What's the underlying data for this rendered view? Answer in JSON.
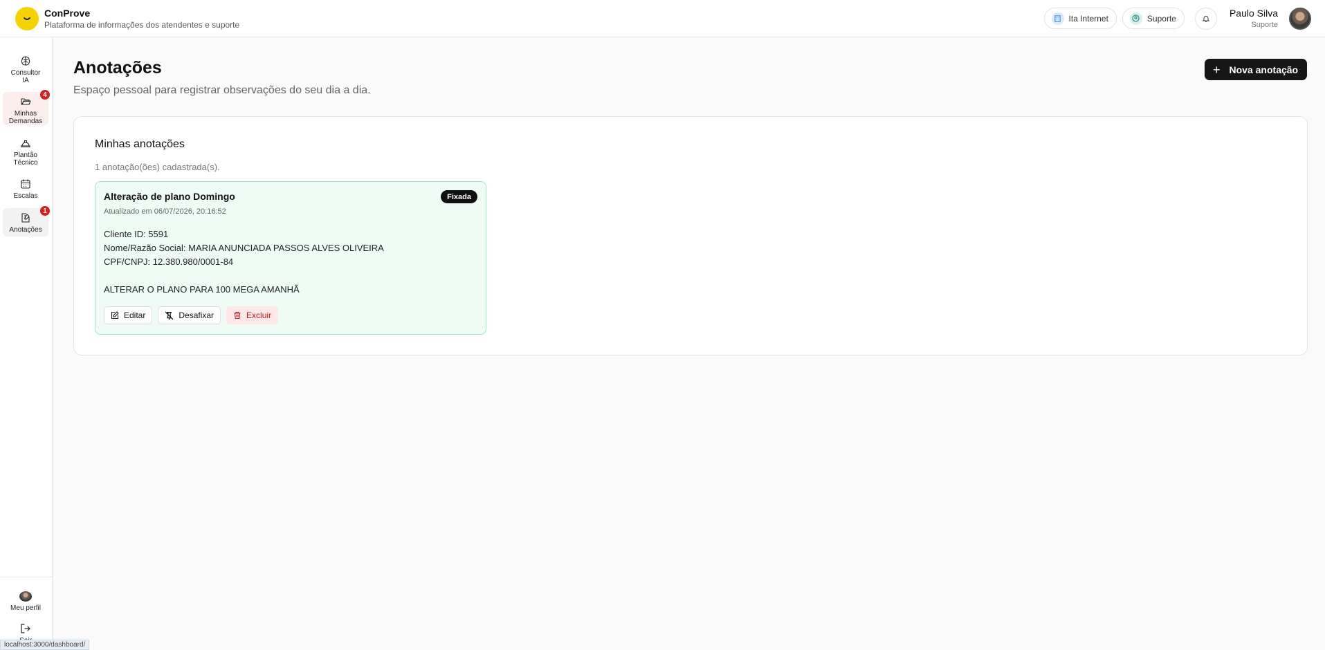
{
  "header": {
    "brand_name": "ConProve",
    "brand_subtitle": "Plataforma de informações dos atendentes e suporte",
    "company_pill": "Ita Internet",
    "support_pill": "Suporte",
    "user_name": "Paulo Silva",
    "user_role": "Suporte"
  },
  "sidebar": {
    "items": [
      {
        "label_line1": "Consultor",
        "label_line2": "IA",
        "icon": "brain-icon"
      },
      {
        "label_line1": "Minhas",
        "label_line2": "Demandas",
        "icon": "folder-open-icon",
        "badge": "4"
      },
      {
        "label_line1": "Plantão",
        "label_line2": "Técnico",
        "icon": "hard-hat-icon"
      },
      {
        "label_line1": "Escalas",
        "label_line2": "",
        "icon": "calendar-icon"
      },
      {
        "label_line1": "Anotações",
        "label_line2": "",
        "icon": "note-edit-icon",
        "badge": "1"
      }
    ],
    "profile_label": "Meu perfil",
    "logout_label": "Sair"
  },
  "page": {
    "title": "Anotações",
    "subtitle": "Espaço pessoal para registrar observações do seu dia a dia.",
    "new_button_label": "Nova anotação"
  },
  "panel": {
    "title": "Minhas anotações",
    "count_text": "1 anotação(ões) cadastrada(s).",
    "notes": [
      {
        "title": "Alteração de plano Domingo",
        "updated": "Atualizado em 06/07/2026, 20:16:52",
        "badge": "Fixada",
        "lines": [
          "Cliente ID: 5591",
          "Nome/Razão Social: MARIA ANUNCIADA PASSOS ALVES OLIVEIRA",
          "CPF/CNPJ: 12.380.980/0001-84",
          "",
          "ALTERAR O PLANO PARA 100 MEGA AMANHÃ"
        ],
        "actions": {
          "edit": "Editar",
          "unpin": "Desafixar",
          "delete": "Excluir"
        }
      }
    ]
  },
  "status_bar": {
    "url": "localhost:3000/dashboard/"
  },
  "colors": {
    "brand": "#f6d200",
    "primary_button": "#161616",
    "note_bg": "#effbf5",
    "note_border": "#9ee3c5",
    "danger": "#c21d1d",
    "badge": "#d42020"
  }
}
